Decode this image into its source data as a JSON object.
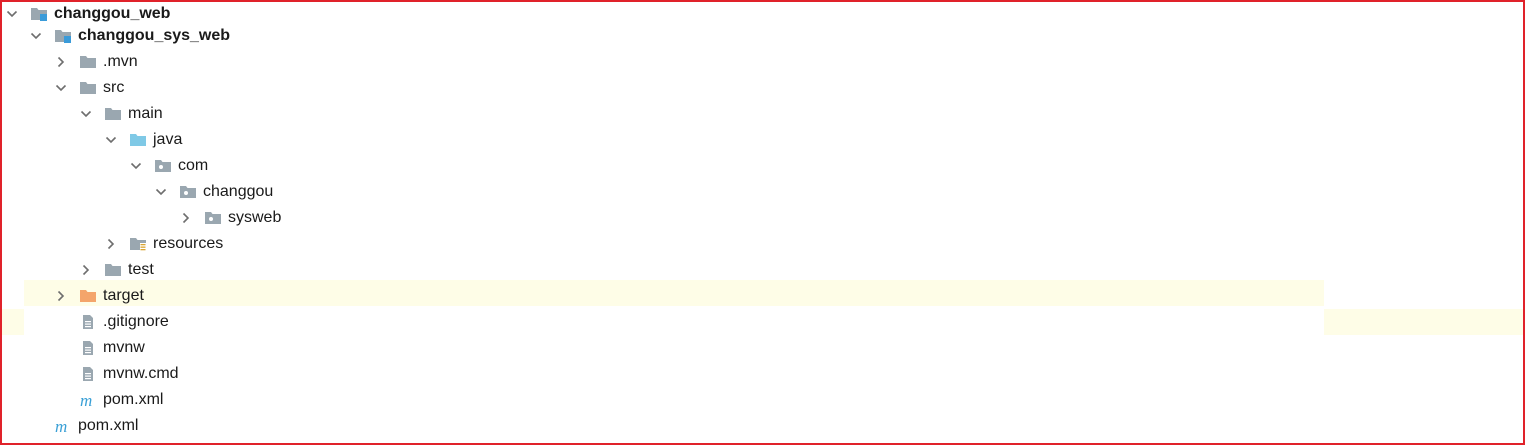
{
  "tree": {
    "items": [
      {
        "label": "changgou_web",
        "icon": "module-folder-icon",
        "expanded": true,
        "bold": true
      },
      {
        "label": "changgou_sys_web",
        "icon": "module-folder-icon",
        "expanded": true,
        "bold": true
      },
      {
        "label": ".mvn",
        "icon": "folder-icon",
        "expanded": false
      },
      {
        "label": "src",
        "icon": "folder-icon",
        "expanded": true
      },
      {
        "label": "main",
        "icon": "folder-icon",
        "expanded": true
      },
      {
        "label": "java",
        "icon": "source-folder-icon",
        "expanded": true
      },
      {
        "label": "com",
        "icon": "package-icon",
        "expanded": true
      },
      {
        "label": "changgou",
        "icon": "package-icon",
        "expanded": true
      },
      {
        "label": "sysweb",
        "icon": "package-icon",
        "expanded": false
      },
      {
        "label": "resources",
        "icon": "resources-folder-icon",
        "expanded": false
      },
      {
        "label": "test",
        "icon": "folder-icon",
        "expanded": false
      },
      {
        "label": "target",
        "icon": "excluded-folder-icon",
        "expanded": false,
        "highlighted": true
      },
      {
        "label": ".gitignore",
        "icon": "text-file-icon"
      },
      {
        "label": "mvnw",
        "icon": "text-file-icon"
      },
      {
        "label": "mvnw.cmd",
        "icon": "text-file-icon"
      },
      {
        "label": "pom.xml",
        "icon": "maven-file-icon"
      },
      {
        "label": "pom.xml",
        "icon": "maven-file-icon"
      }
    ]
  },
  "colors": {
    "frame_border": "#e0222a",
    "highlight_row": "#fefde7",
    "folder_gray": "#9aa7b0",
    "source_blue": "#7fc9e6",
    "excluded_orange": "#f4a56b",
    "module_blue": "#3a9bd9",
    "maven_blue": "#3aa0d6"
  }
}
